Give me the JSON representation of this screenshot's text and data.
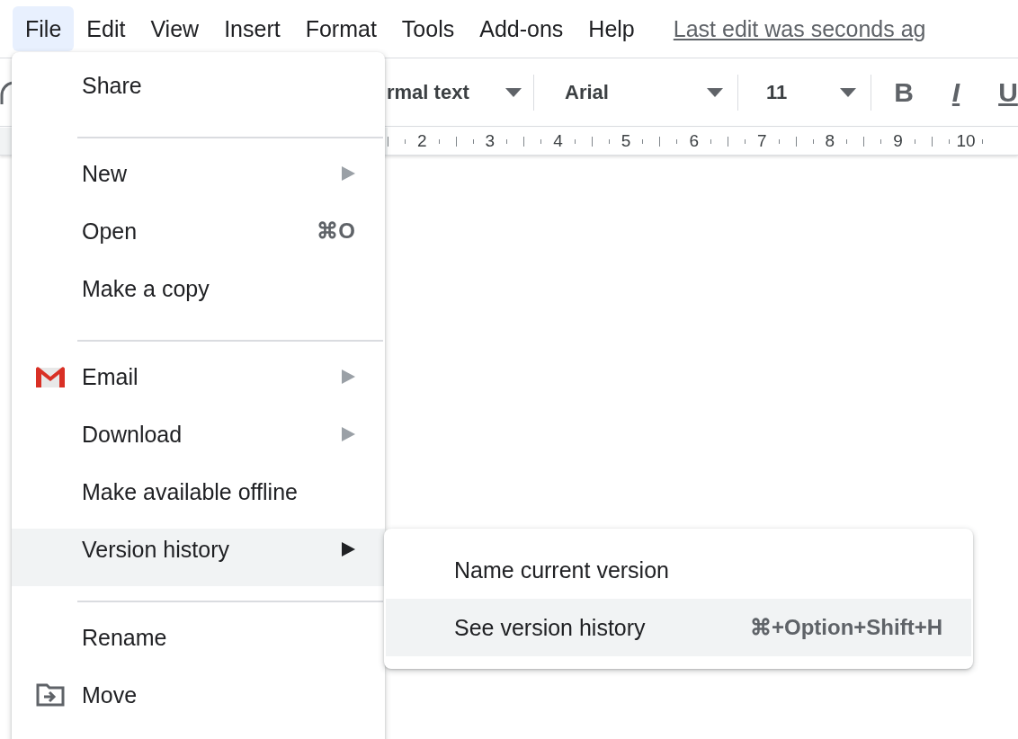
{
  "menubar": {
    "items": [
      {
        "label": "File",
        "selected": true
      },
      {
        "label": "Edit",
        "selected": false
      },
      {
        "label": "View",
        "selected": false
      },
      {
        "label": "Insert",
        "selected": false
      },
      {
        "label": "Format",
        "selected": false
      },
      {
        "label": "Tools",
        "selected": false
      },
      {
        "label": "Add-ons",
        "selected": false
      },
      {
        "label": "Help",
        "selected": false
      }
    ],
    "last_edit": "Last edit was seconds ag"
  },
  "toolbar": {
    "style": "rmal text",
    "font": "Arial",
    "size": "11",
    "format_buttons": [
      "B",
      "I",
      "U"
    ]
  },
  "ruler": {
    "labels": [
      "2",
      "3",
      "4",
      "5",
      "6",
      "7",
      "8",
      "9",
      "10"
    ]
  },
  "file_menu": {
    "sections": [
      [
        {
          "label": "Share",
          "submenu": false,
          "selected": false
        }
      ],
      [
        {
          "label": "New",
          "submenu": true,
          "selected": false
        },
        {
          "label": "Open",
          "shortcut": "⌘O",
          "submenu": false,
          "selected": false
        },
        {
          "label": "Make a copy",
          "submenu": false,
          "selected": false
        }
      ],
      [
        {
          "label": "Email",
          "submenu": true,
          "selected": false
        },
        {
          "label": "Download",
          "submenu": true,
          "selected": false
        },
        {
          "label": "Make available offline",
          "submenu": false,
          "selected": false
        },
        {
          "label": "Version history",
          "submenu": true,
          "selected": true
        }
      ],
      [
        {
          "label": "Rename",
          "submenu": false,
          "selected": false
        },
        {
          "label": "Move",
          "submenu": false,
          "selected": false
        }
      ]
    ]
  },
  "version_submenu": {
    "items": [
      {
        "label": "Name current version",
        "selected": false
      },
      {
        "label": "See version history",
        "shortcut": "⌘+Option+Shift+H",
        "selected": true
      }
    ]
  }
}
